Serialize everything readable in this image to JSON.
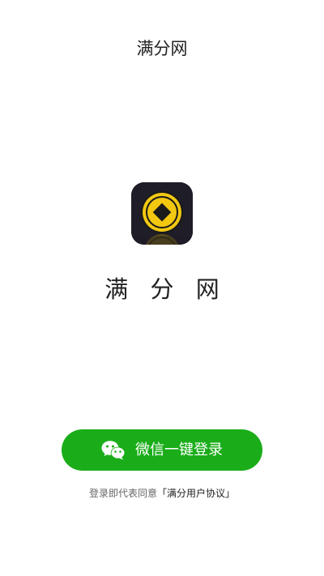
{
  "header": {
    "title": "满分网"
  },
  "app": {
    "name": "满 分 网"
  },
  "login": {
    "button_label": "微信一键登录",
    "icon": "wechat-icon"
  },
  "agreement": {
    "prefix": "登录即代表同意",
    "link": "「满分用户协议」"
  },
  "colors": {
    "button": "#1aad19",
    "logo_background": "#1f1d27",
    "coin": "#f2c811"
  }
}
